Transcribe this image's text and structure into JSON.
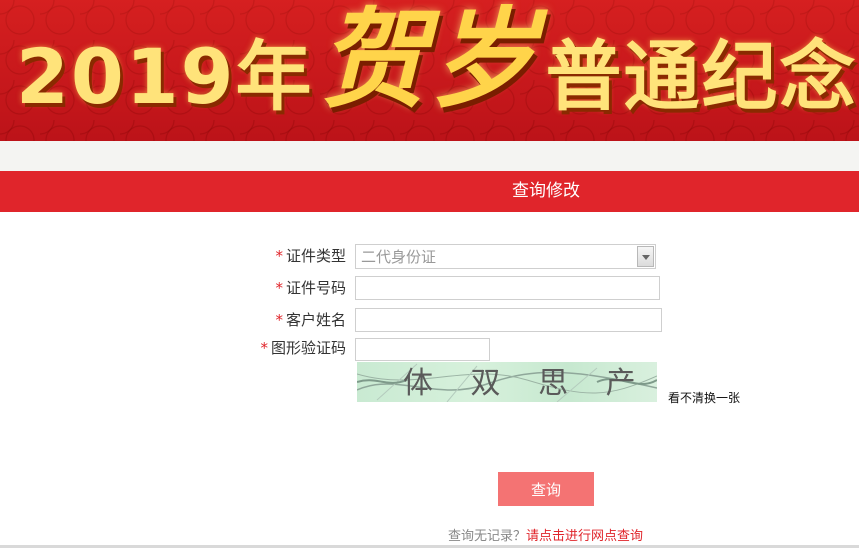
{
  "banner": {
    "year": "2019年",
    "brush_text": "贺岁",
    "rest": "普通纪念币"
  },
  "section": {
    "title": "查询修改"
  },
  "form": {
    "id_type": {
      "label": "证件类型",
      "selected": "二代身份证"
    },
    "id_number": {
      "label": "证件号码",
      "value": ""
    },
    "name": {
      "label": "客户姓名",
      "value": ""
    },
    "captcha": {
      "label": "图形验证码",
      "value": "",
      "image_text": "体 双 思 产 香",
      "refresh": "看不清换一张"
    },
    "required_mark": "*"
  },
  "actions": {
    "query": "查询"
  },
  "footer": {
    "note": "查询无记录？",
    "link": "请点击进行网点查询"
  },
  "colors": {
    "brand_red": "#e0252b",
    "button": "#f47373",
    "banner": "#c8161d",
    "gold": "#ffe37a"
  }
}
